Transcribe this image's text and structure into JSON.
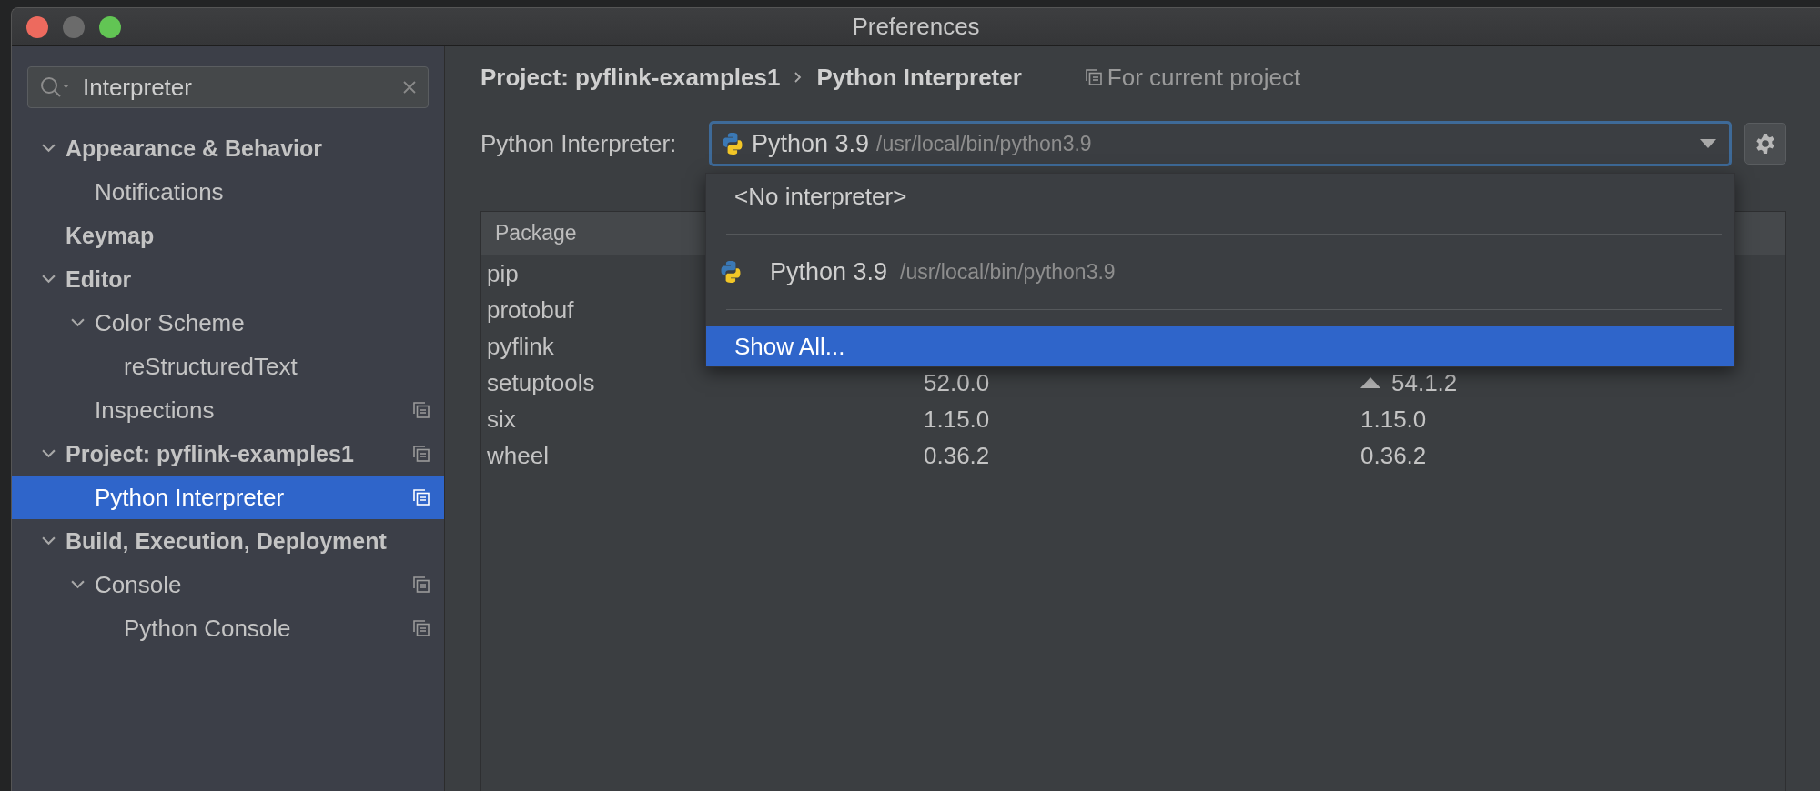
{
  "window": {
    "title": "Preferences"
  },
  "search": {
    "value": "Interpreter"
  },
  "tree": [
    {
      "label": "Appearance & Behavior",
      "expanded": true,
      "selected": false,
      "project_level": false,
      "children": [
        {
          "label": "Notifications",
          "selected": false,
          "project_level": false
        }
      ]
    },
    {
      "label": "Keymap",
      "selected": false,
      "project_level": false
    },
    {
      "label": "Editor",
      "expanded": true,
      "selected": false,
      "project_level": false,
      "children": [
        {
          "label": "Color Scheme",
          "expanded": true,
          "selected": false,
          "project_level": false,
          "children": [
            {
              "label": "reStructuredText",
              "selected": false,
              "project_level": false
            }
          ]
        },
        {
          "label": "Inspections",
          "selected": false,
          "project_level": true
        }
      ]
    },
    {
      "label": "Project: pyflink-examples1",
      "expanded": true,
      "selected": false,
      "project_level": true,
      "children": [
        {
          "label": "Python Interpreter",
          "selected": true,
          "project_level": true
        }
      ]
    },
    {
      "label": "Build, Execution, Deployment",
      "expanded": true,
      "selected": false,
      "project_level": false,
      "children": [
        {
          "label": "Console",
          "expanded": true,
          "selected": false,
          "project_level": true,
          "children": [
            {
              "label": "Python Console",
              "selected": false,
              "project_level": true
            }
          ]
        }
      ]
    }
  ],
  "breadcrumb": [
    "Project: pyflink-examples1",
    "Python Interpreter"
  ],
  "scope_note": "For current project",
  "interpreter": {
    "label": "Python Interpreter:",
    "name": "Python 3.9",
    "path": "/usr/local/bin/python3.9"
  },
  "dropdown": [
    {
      "kind": "plain",
      "label": "<No interpreter>",
      "selected": false
    },
    {
      "kind": "separator"
    },
    {
      "kind": "python",
      "label": "Python 3.9",
      "path": "/usr/local/bin/python3.9",
      "selected": false
    },
    {
      "kind": "separator"
    },
    {
      "kind": "plain",
      "label": "Show All...",
      "selected": true
    }
  ],
  "table": {
    "columns": [
      "Package"
    ],
    "rows": [
      {
        "package": "pip"
      },
      {
        "package": "protobuf"
      },
      {
        "package": "pyflink"
      },
      {
        "package": "setuptools",
        "version": "52.0.0",
        "latest": "54.1.2",
        "upgrade": true
      },
      {
        "package": "six",
        "version": "1.15.0",
        "latest": "1.15.0",
        "upgrade": false
      },
      {
        "package": "wheel",
        "version": "0.36.2",
        "latest": "0.36.2",
        "upgrade": false
      }
    ]
  }
}
